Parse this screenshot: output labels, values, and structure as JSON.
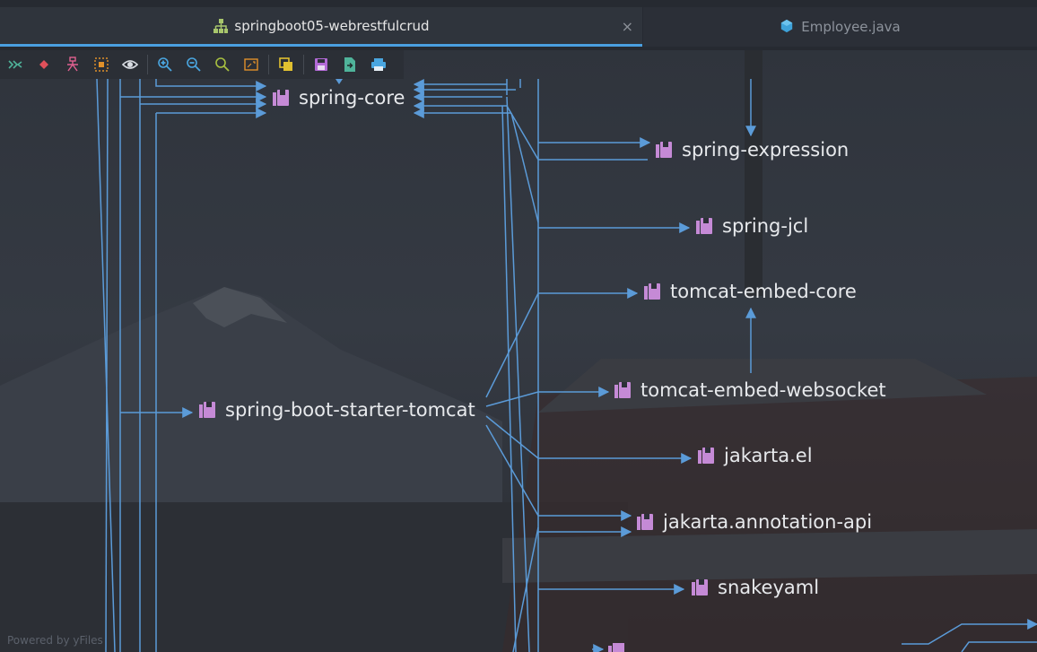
{
  "tabs": {
    "active": {
      "label": "springboot05-webrestfulcrud",
      "icon": "hierarchy-icon",
      "close": "×"
    },
    "inactive": {
      "label": "Employee.java",
      "icon": "java-class-icon"
    }
  },
  "toolbar": {
    "icons": [
      "expand-all-icon",
      "select-node-icon",
      "layout-icon",
      "group-icon",
      "show-icon",
      "zoom-in-icon",
      "zoom-out-icon",
      "actual-size-icon",
      "fit-content-icon",
      "export-icon",
      "save-icon",
      "export-file-icon",
      "print-icon"
    ]
  },
  "nodes": {
    "spring_core": "spring-core",
    "spring_expression": "spring-expression",
    "spring_jcl": "spring-jcl",
    "tomcat_embed_core": "tomcat-embed-core",
    "spring_boot_starter_tomcat": "spring-boot-starter-tomcat",
    "tomcat_embed_websocket": "tomcat-embed-websocket",
    "jakarta_el": "jakarta.el",
    "jakarta_annotation_api": "jakarta.annotation-api",
    "snakeyaml": "snakeyaml"
  },
  "colors": {
    "edge": "#5b9bd8",
    "node_icon": "#c58ad6",
    "tab_accent": "#4a9fe0"
  },
  "watermark": "Powered by yFiles"
}
